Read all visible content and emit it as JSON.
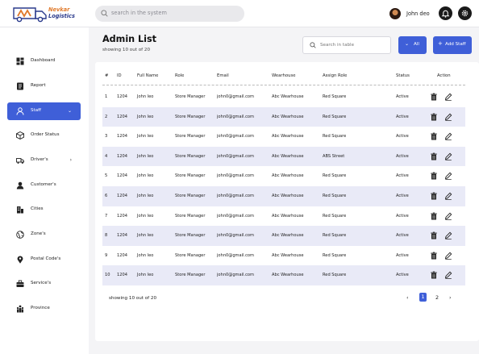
{
  "brand": {
    "line1": "Nevkar",
    "line2": "Logistics"
  },
  "header": {
    "search_placeholder": "search in the system",
    "user_name": "John deo"
  },
  "sidebar": {
    "items": [
      {
        "label": "Dashboard",
        "icon": "dashboard-icon"
      },
      {
        "label": "Report",
        "icon": "report-icon"
      },
      {
        "label": "Staff",
        "icon": "staff-icon",
        "active": true,
        "chevron": "⌄"
      },
      {
        "label": "Order Status",
        "icon": "order-status-icon"
      },
      {
        "label": "Driver's",
        "icon": "truck-icon",
        "chevron": "›"
      },
      {
        "label": "Customer's",
        "icon": "customer-icon"
      },
      {
        "label": "Cities",
        "icon": "cities-icon"
      },
      {
        "label": "Zone's",
        "icon": "globe-icon"
      },
      {
        "label": "Postal Code's",
        "icon": "location-pin-icon"
      },
      {
        "label": "Service's",
        "icon": "briefcase-icon"
      },
      {
        "label": "Province",
        "icon": "province-icon"
      }
    ]
  },
  "main": {
    "title": "Admin List",
    "subtitle": "showing 10 out of 20",
    "table_search_placeholder": "Search in table",
    "filter_label": "All",
    "add_label": "Add Staff",
    "columns": [
      "#",
      "ID",
      "Full Name",
      "Role",
      "Email",
      "Wearhouse",
      "Assign Role",
      "Status",
      "Action"
    ],
    "rows": [
      [
        "1",
        "1204",
        "John leo",
        "Store Manager",
        "john0@gmail.com",
        "Abc Wearhouse",
        "Red Square",
        "Active"
      ],
      [
        "2",
        "1204",
        "John leo",
        "Store Manager",
        "john0@gmail.com",
        "Abc Wearhouse",
        "Red Square",
        "Active"
      ],
      [
        "3",
        "1204",
        "John leo",
        "Store Manager",
        "john0@gmail.com",
        "Abc Wearhouse",
        "Red Square",
        "Active"
      ],
      [
        "4",
        "1204",
        "John leo",
        "Store Manager",
        "john0@gmail.com",
        "Abc Wearhouse",
        "ABS Street",
        "Active"
      ],
      [
        "5",
        "1204",
        "John leo",
        "Store Manager",
        "john0@gmail.com",
        "Abc Wearhouse",
        "Red Square",
        "Active"
      ],
      [
        "6",
        "1204",
        "John leo",
        "Store Manager",
        "john0@gmail.com",
        "Abc Wearhouse",
        "Red Square",
        "Active"
      ],
      [
        "7",
        "1204",
        "John leo",
        "Store Manager",
        "john0@gmail.com",
        "Abc Wearhouse",
        "Red Square",
        "Active"
      ],
      [
        "8",
        "1204",
        "John leo",
        "Store Manager",
        "john0@gmail.com",
        "Abc Wearhouse",
        "Red Square",
        "Active"
      ],
      [
        "9",
        "1204",
        "John leo",
        "Store Manager",
        "john0@gmail.com",
        "Abc Wearhouse",
        "Red Square",
        "Active"
      ],
      [
        "10",
        "1204",
        "John leo",
        "Store Manager",
        "john0@gmail.com",
        "Abc Wearhouse",
        "Red Square",
        "Active"
      ]
    ],
    "footer_text": "showing 10 out of 20",
    "pagination": {
      "prev": "‹",
      "pages": [
        "1",
        "2"
      ],
      "current": "1",
      "next": "›"
    }
  },
  "colors": {
    "accent": "#3f5fd8",
    "row_shade": "#e9eaf7",
    "brand_orange": "#e07a2c",
    "brand_blue": "#2a3a8c"
  }
}
